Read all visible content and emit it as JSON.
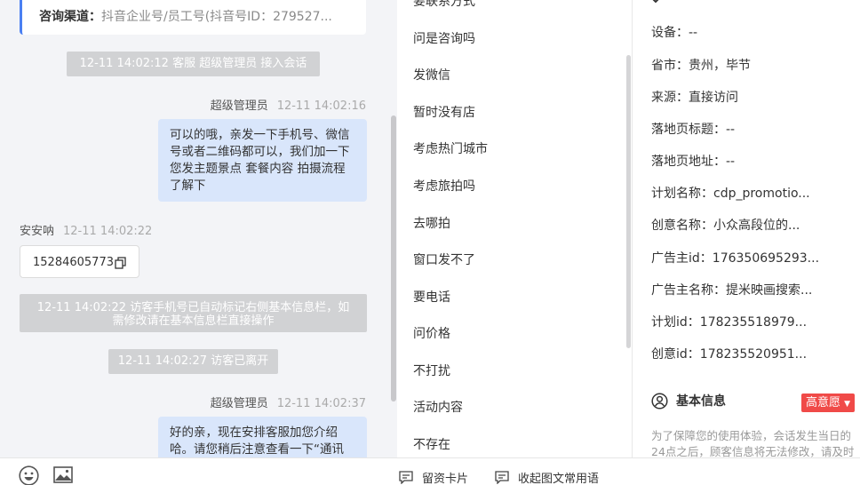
{
  "chat": {
    "info_card": {
      "label": "咨询渠道：",
      "value": "抖音企业号/员工号(抖音号ID：279527..."
    },
    "messages": [
      {
        "type": "system",
        "text": "12-11 14:02:12 客服 超级管理员 接入会话"
      },
      {
        "type": "agent",
        "name": "超级管理员",
        "time": "12-11 14:02:16",
        "text": "可以的哦，亲发一下手机号、微信号或者二维码都可以，我们加一下您发主题景点 套餐内容 拍摄流程了解下"
      },
      {
        "type": "visitor",
        "name": "安安呐",
        "time": "12-11 14:02:22",
        "text": "15284605773"
      },
      {
        "type": "system",
        "text": "12-11 14:02:22 访客手机号已自动标记右侧基本信息栏，如需修改请在基本信息栏直接操作"
      },
      {
        "type": "system",
        "text": "12-11 14:02:27 访客已离开"
      },
      {
        "type": "agent",
        "name": "超级管理员",
        "time": "12-11 14:02:37",
        "text": "好的亲，现在安排客服加您介绍哈。请您稍后注意查看一下“通讯"
      }
    ]
  },
  "quick_replies": {
    "items": [
      "要联系方式",
      "问是咨询吗",
      "发微信",
      "暂时没有店",
      "考虑热门城市",
      "考虑旅拍吗",
      "去哪拍",
      "窗口发不了",
      "要电话",
      "问价格",
      "不打扰",
      "活动内容",
      "不存在"
    ]
  },
  "info": {
    "rows": [
      {
        "label": "设备：",
        "value": "--"
      },
      {
        "label": "省市：",
        "value": "贵州，毕节"
      },
      {
        "label": "来源：",
        "value": "直接访问"
      },
      {
        "label": "落地页标题：",
        "value": "--"
      },
      {
        "label": "落地页地址：",
        "value": "--"
      },
      {
        "label": "计划名称：",
        "value": "cdp_promotio..."
      },
      {
        "label": "创意名称：",
        "value": "小众高段位的..."
      },
      {
        "label": "广告主id：",
        "value": "176350695293..."
      },
      {
        "label": "广告主名称：",
        "value": "提米映画搜索..."
      },
      {
        "label": "计划id：",
        "value": "178235518979..."
      },
      {
        "label": "创意id：",
        "value": "178235520951..."
      }
    ],
    "basic_title": "基本信息",
    "intent_badge": "高意愿",
    "notice": "为了保障您的使用体验，会话发生当日的24点之后，顾客信息将无法修改，请及时填写"
  },
  "footer": {
    "card_label": "留资卡片",
    "phrases_label": "收起图文常用语"
  },
  "colors": {
    "accent": "#4a7ff2",
    "agent_bubble": "#d9e6fb",
    "badge": "#f04a48",
    "system_pill": "#d1d2d4"
  }
}
